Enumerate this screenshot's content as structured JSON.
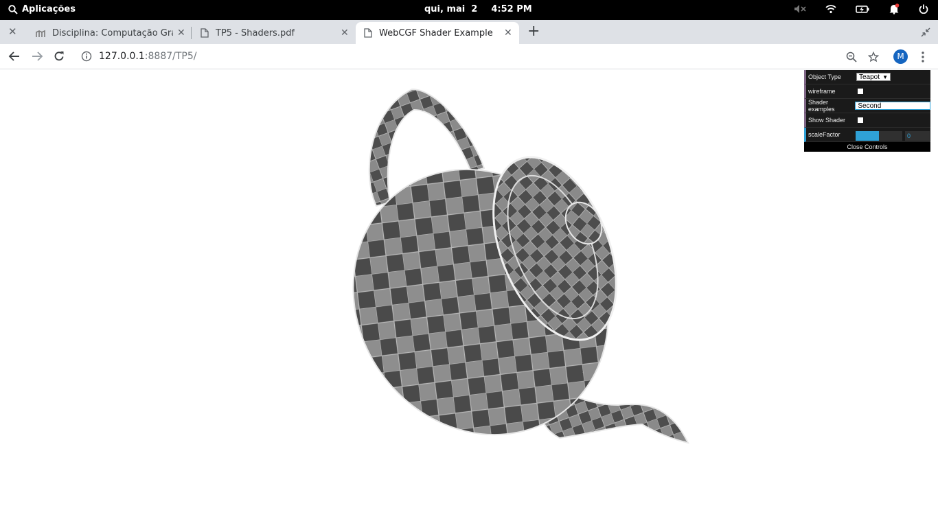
{
  "system": {
    "apps_label": "Aplicações",
    "date": "qui, mai  2",
    "time": "4:52 PM"
  },
  "tabs": [
    {
      "title": "Disciplina: Computação Gráfica",
      "icon": "moodle-icon"
    },
    {
      "title": "TP5 - Shaders.pdf",
      "icon": "document-icon"
    },
    {
      "title": "WebCGF Shader Example",
      "icon": "document-icon",
      "active": true
    }
  ],
  "address": {
    "host": "127.0.0.1",
    "rest": ":8887/TP5/"
  },
  "profile_initial": "M",
  "gui": {
    "object_type_label": "Object Type",
    "object_type_value": "Teapot",
    "wireframe_label": "wireframe",
    "shader_label": "Shader examples",
    "shader_value": "Second",
    "show_shader_label": "Show Shader",
    "scale_label": "scaleFactor",
    "scale_value": "0",
    "scale_fill": 0.5,
    "close_label": "Close Controls"
  },
  "colors": {
    "gui_accent": "#2fa1d6",
    "gui_bg": "#1a1a1a"
  }
}
